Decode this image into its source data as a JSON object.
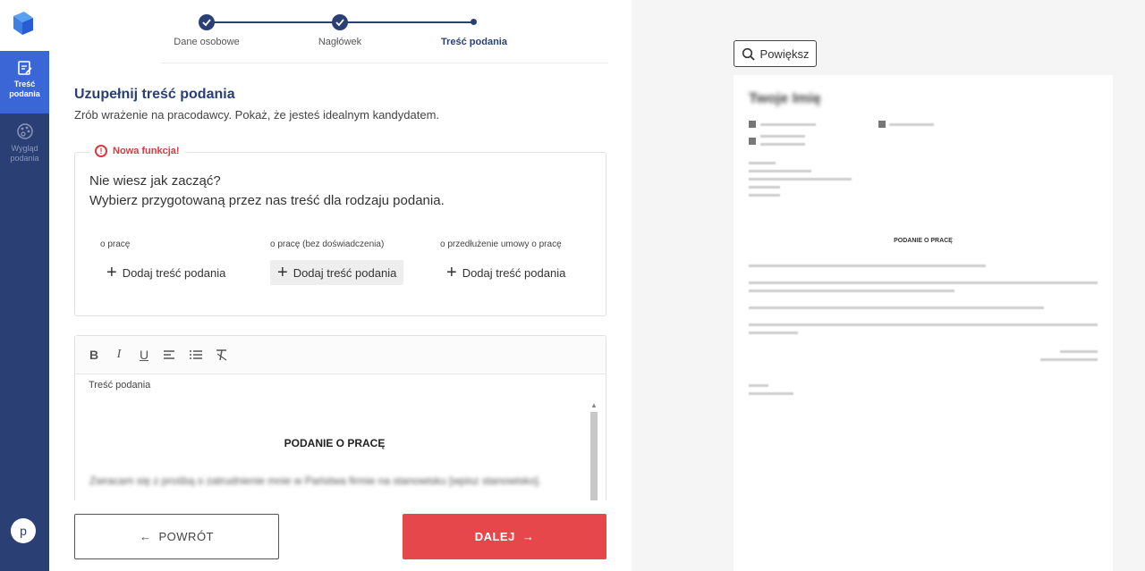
{
  "sidebar": {
    "items": [
      {
        "label": "Treść podania",
        "icon": "edit-document-icon",
        "active": true
      },
      {
        "label": "Wygląd podania",
        "icon": "palette-icon",
        "active": false
      }
    ],
    "avatar_letter": "p"
  },
  "stepper": {
    "steps": [
      {
        "label": "Dane osobowe",
        "state": "completed"
      },
      {
        "label": "Nagłówek",
        "state": "completed"
      },
      {
        "label": "Treść podania",
        "state": "current"
      }
    ]
  },
  "main": {
    "title": "Uzupełnij treść podania",
    "subtitle": "Zrób wrażenie na pracodawcy. Pokaż, że jesteś idealnym kandydatem.",
    "new_feature": {
      "badge": "Nowa funkcja!",
      "question": "Nie wiesz jak zacząć?",
      "instruction": "Wybierz przygotowaną przez nas treść dla rodzaju podania.",
      "options": [
        {
          "label": "o pracę",
          "button": "Dodaj treść podania"
        },
        {
          "label": "o pracę (bez doświadczenia)",
          "button": "Dodaj treść podania"
        },
        {
          "label": "o przedłużenie umowy o pracę",
          "button": "Dodaj treść podania"
        }
      ]
    },
    "editor": {
      "label": "Treść podania",
      "doc_title": "PODANIE O PRACĘ",
      "body_preview": "Zwracam się z prośbą o zatrudnienie mnie w Państwa firmie na stanowisku [wpisz stanowisko]."
    }
  },
  "footer": {
    "back_label": "POWRÓT",
    "next_label": "DALEJ"
  },
  "preview": {
    "zoom_label": "Powiększ",
    "name": "Twoje Imię",
    "doc_title": "PODANIE O PRACĘ"
  },
  "colors": {
    "sidebar": "#2a3f73",
    "sidebar_active": "#3a66d6",
    "accent_red": "#e5474b",
    "preview_bg": "#f5f5f5"
  }
}
